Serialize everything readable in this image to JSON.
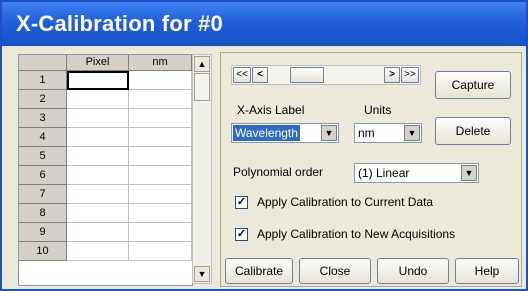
{
  "window": {
    "title": "X-Calibration for #0"
  },
  "grid": {
    "columns": [
      "Pixel",
      "nm"
    ],
    "rows": [
      "1",
      "2",
      "3",
      "4",
      "5",
      "6",
      "7",
      "8",
      "9",
      "10"
    ],
    "scroll_up": "▲",
    "scroll_down": "▼"
  },
  "scroll": {
    "first": "<<",
    "prev": "<",
    "next": ">",
    "last": ">>"
  },
  "buttons": {
    "capture": "Capture",
    "delete": "Delete",
    "calibrate": "Calibrate",
    "close": "Close",
    "undo": "Undo",
    "help": "Help"
  },
  "xaxis": {
    "label": "X-Axis Label",
    "value": "Wavelength"
  },
  "units": {
    "label": "Units",
    "value": "nm"
  },
  "polynomial": {
    "label": "Polynomial order",
    "value": "(1) Linear"
  },
  "apply_current": {
    "label": "Apply Calibration to Current Data",
    "checked": true,
    "mark": "✓"
  },
  "apply_new": {
    "label": "Apply Calibration to New Acquisitions",
    "checked": true,
    "mark": "✓"
  },
  "dropdown_arrow": "▼"
}
